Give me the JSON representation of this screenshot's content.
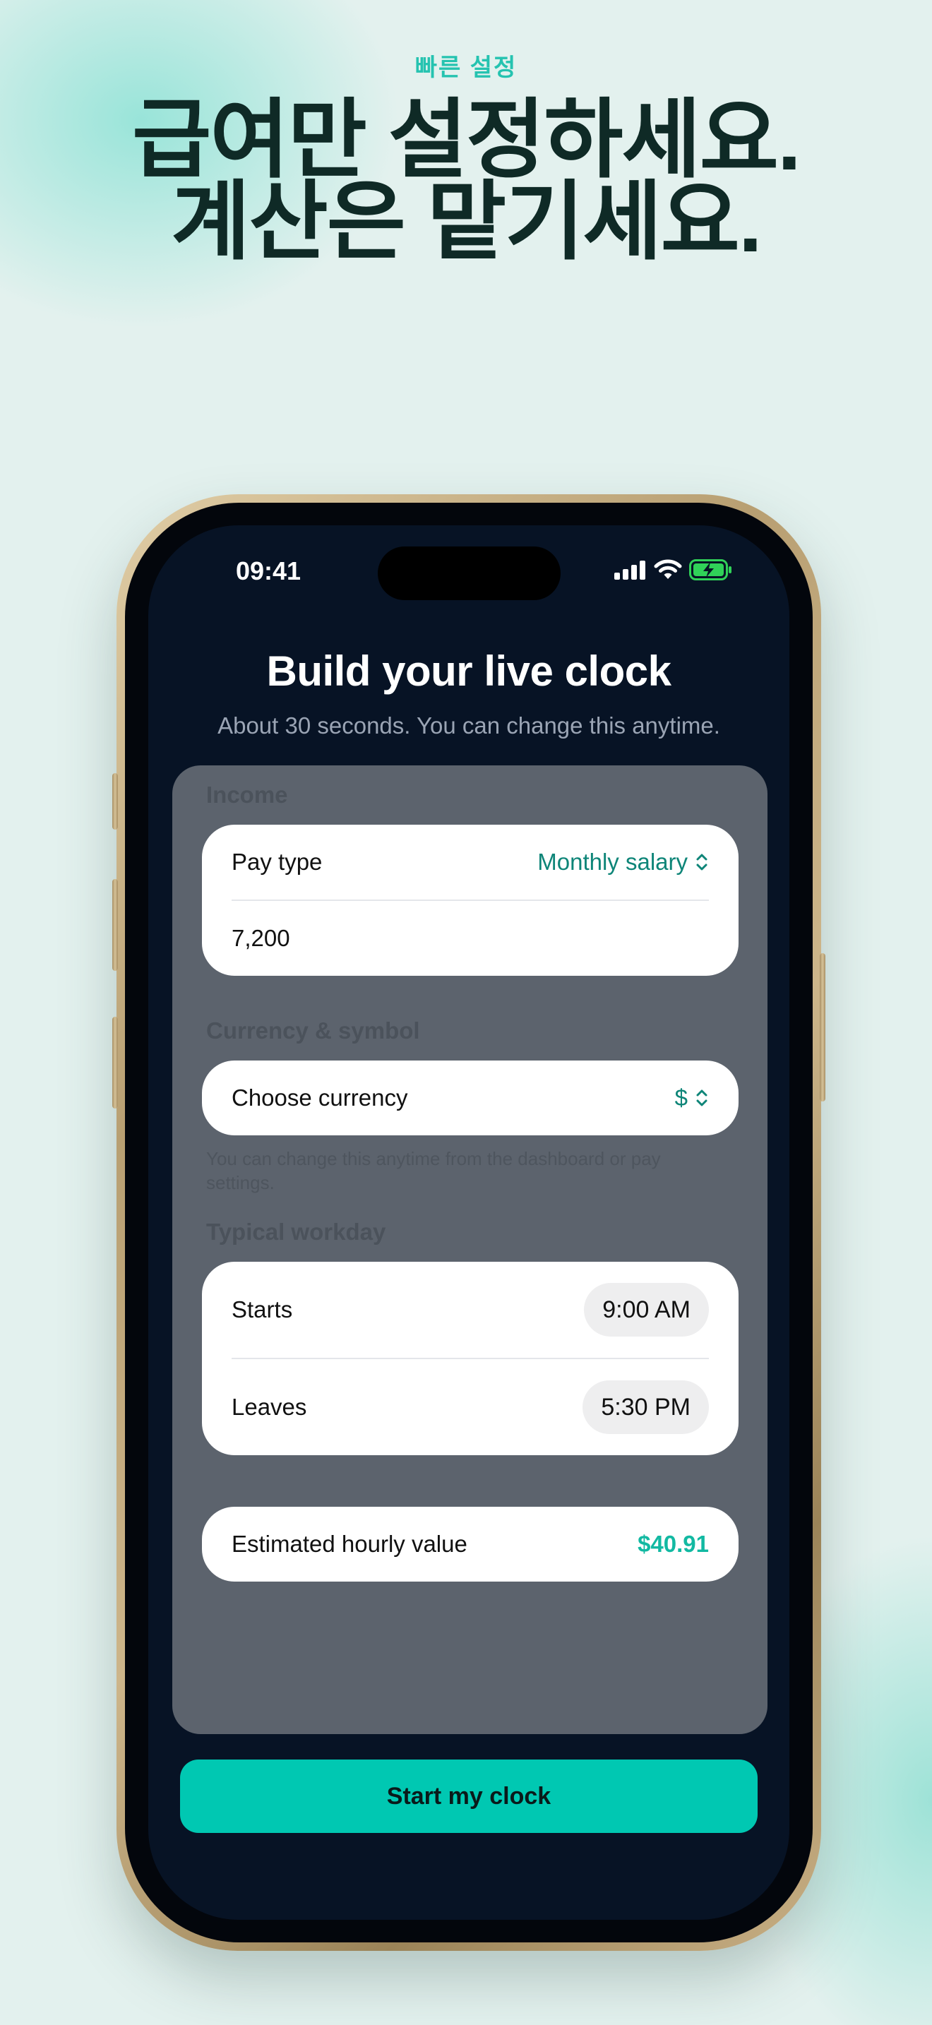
{
  "marketing": {
    "eyebrow": "빠른 설정",
    "headline_line1": "급여만 설정하세요.",
    "headline_line2": "계산은 맡기세요."
  },
  "status_bar": {
    "time": "09:41",
    "icons": [
      "signal-icon",
      "wifi-icon",
      "battery-charging-icon"
    ]
  },
  "screen": {
    "title": "Build your live clock",
    "subtitle": "About 30 seconds. You can change this anytime."
  },
  "income": {
    "section_label": "Income",
    "pay_type_label": "Pay type",
    "pay_type_value": "Monthly salary",
    "amount_value": "7,200"
  },
  "currency": {
    "section_label": "Currency & symbol",
    "choose_label": "Choose currency",
    "symbol_value": "$",
    "helper_text": "You can change this anytime from the dashboard or pay settings."
  },
  "workday": {
    "section_label": "Typical workday",
    "starts_label": "Starts",
    "starts_value": "9:00 AM",
    "leaves_label": "Leaves",
    "leaves_value": "5:30 PM"
  },
  "estimate": {
    "label": "Estimated hourly value",
    "value": "$40.91"
  },
  "cta": {
    "label": "Start my clock"
  },
  "colors": {
    "accent": "#00c8b2",
    "accent_text": "#0e8578",
    "screen_background": "#071325",
    "panel": "#5c636d",
    "page_background": "#e3f1ee"
  }
}
